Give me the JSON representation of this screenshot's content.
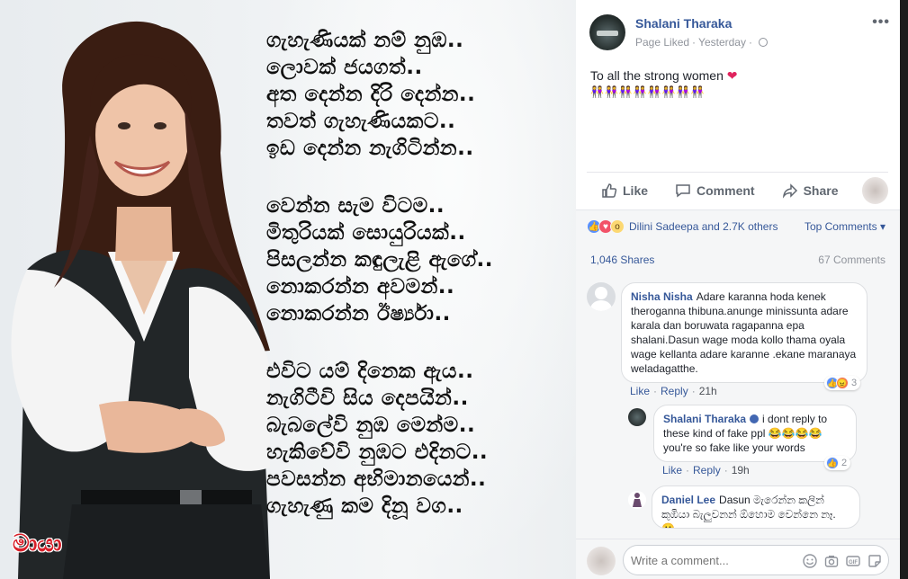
{
  "image": {
    "poem_stanzas": [
      [
        "ගැහැණියක් නම් නුඹ..",
        "ලොවක් ජයගත්..",
        "අත දෙන්න දිරි දෙන්න..",
        "තවත් ගැහැණියකට..",
        "ඉඩ දෙන්න නැගිටින්න.."
      ],
      [
        "වෙන්න සැම විටම..",
        "මිතුරියක් සොයුරියක්..",
        "පිසලන්න කඳුලැළි ඇගේ..",
        "නොකරන්න අවමන්..",
        "නොකරන්න ඊර්ෂ්‍යා.."
      ],
      [
        "එවිට යම් දිනෙක ඇය..",
        "නැගිටීවි සිය දෙපයින්..",
        "බැබලේවි නුඹ මෙන්ම..",
        "හැකිවේවි නුඹට එදිනට..",
        "පවසන්න අභිමානයෙන්..",
        "ගැහැණු කම දිනූ වග.."
      ]
    ],
    "watermark": "මායා"
  },
  "post": {
    "page_name": "Shalani Tharaka",
    "status": "Page Liked",
    "time": "Yesterday",
    "more_icon": "more-dots-icon",
    "text": "To all the strong women",
    "text_emoji": "❤",
    "emoji_row": "👭👭👭👭👭👭👭👭",
    "actions": {
      "like": "Like",
      "comment": "Comment",
      "share": "Share"
    }
  },
  "reactions": {
    "summary": "Dilini Sadeepa and 2.7K others",
    "sort_label": "Top Comments ▾",
    "shares": "1,046 Shares",
    "comments_count": "67 Comments"
  },
  "comments": [
    {
      "author": "Nisha Nisha",
      "text": "Adare karanna hoda kenek theroganna thibuna.anunge minissunta adare karala dan boruwata ragapanna epa shalani.Dasun wage moda kollo thama oyala wage kellanta adare karanne .ekane maranaya weladagatthe.",
      "like": "Like",
      "reply": "Reply",
      "time": "21h",
      "reaction_count": "3"
    },
    {
      "author": "Shalani Tharaka",
      "text": "i dont reply to these kind of fake ppl 😂😂😂😂 you're so fake like your words",
      "like": "Like",
      "reply": "Reply",
      "time": "19h",
      "reaction_count": "2"
    },
    {
      "author": "Daniel Lee",
      "text": "Dasun මැරෙන්න කලින් කුඹියා බැලුවනන් ඕහොම වෙන්නෙ නෑ. 😀"
    }
  ],
  "composer": {
    "placeholder": "Write a comment..."
  },
  "colors": {
    "link": "#365899",
    "muted": "#90949c",
    "watermark": "#d8202a"
  }
}
